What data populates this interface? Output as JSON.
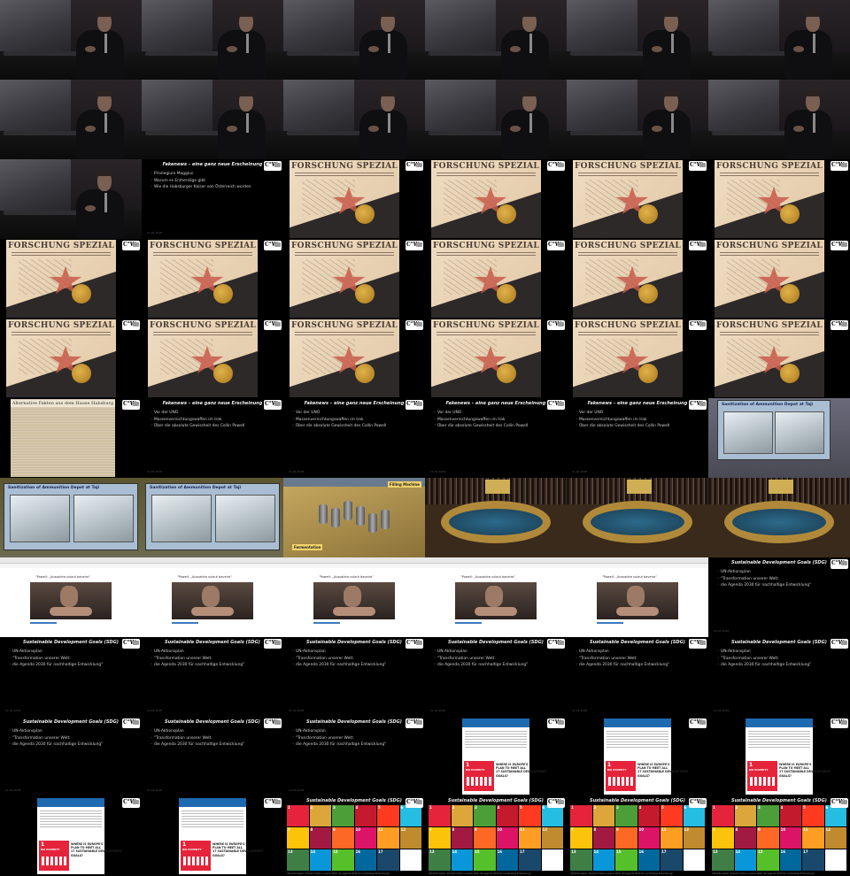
{
  "layout": {
    "columns": 6,
    "rows": 11,
    "cells": [
      "speaker",
      "speaker",
      "speaker",
      "speaker",
      "speaker",
      "speaker",
      "speaker",
      "speaker",
      "speaker",
      "speaker",
      "speaker",
      "speaker",
      "speaker",
      "fakenews-title",
      "newspaper",
      "newspaper",
      "newspaper",
      "newspaper",
      "newspaper",
      "newspaper",
      "newspaper",
      "newspaper",
      "newspaper",
      "newspaper",
      "newspaper",
      "newspaper",
      "newspaper",
      "newspaper",
      "newspaper",
      "newspaper",
      "oldpaper",
      "fakenews-uno",
      "fakenews-uno",
      "fakenews-uno",
      "fakenews-uno",
      "ammo-photo",
      "ammo",
      "ammo",
      "filling",
      "council",
      "council",
      "council",
      "browser",
      "browser",
      "browser",
      "browser",
      "browser",
      "sdg-text",
      "sdg-text",
      "sdg-text",
      "sdg-text",
      "sdg-text",
      "sdg-text",
      "sdg-text",
      "sdg-text",
      "sdg-text",
      "sdg-text",
      "sdg-poster",
      "sdg-poster",
      "sdg-poster",
      "sdg-poster",
      "sdg-poster",
      "sdg-grid",
      "sdg-grid",
      "sdg-grid",
      "sdg-grid"
    ]
  },
  "slides": {
    "fakenews_title": "Fakenews – eine ganz neue Erscheinung",
    "fakenews_bullets_1": [
      "Privilegium Maggius",
      "Warum es Erzherzöge gibt",
      "Wie die Habsburger Kaiser von Österreich wurden"
    ],
    "fakenews_bullets_2": [
      "Vor der UNO",
      "Massenvernichtungswaffen im Irak",
      "Über die absolute Gewissheit des Collin Powell"
    ],
    "sdg_title": "Sustainable Development Goals (SDG)",
    "sdg_bullets": [
      "UN-Aktionsplan",
      "\"Transformation unserer Welt:",
      "die Agenda 2030 für nachhaltige Entwicklung\""
    ],
    "date_stamp": "11.01.2018"
  },
  "newspaper": {
    "masthead": "FORSCHUNG SPEZIAL",
    "old_headline": "Alternative Fakten aus dem Hause Habsburg"
  },
  "photos": {
    "ammo_title": "Sanitization of Ammunition Depot at Taji",
    "filling_label": "Filling Machine",
    "fermentation_label": "Fermentation",
    "browser_headline": "\"Powell: „Aussaldra sulaut baveiro\""
  },
  "sdg_poster": {
    "goal_number": "1",
    "goal_name": "NO POVERTY",
    "claim": "WHERE IS EUROPE'S\nPLAN TO MEET ALL\n17 SUSTAINABLE DEVELOPMENT\nGOALS?"
  },
  "sdg_goals": [
    {
      "n": "1",
      "color": "#e5243b"
    },
    {
      "n": "2",
      "color": "#dda63a"
    },
    {
      "n": "3",
      "color": "#4c9f38"
    },
    {
      "n": "4",
      "color": "#c5192d"
    },
    {
      "n": "5",
      "color": "#ff3a21"
    },
    {
      "n": "6",
      "color": "#26bde2"
    },
    {
      "n": "7",
      "color": "#fcc30b"
    },
    {
      "n": "8",
      "color": "#a21942"
    },
    {
      "n": "9",
      "color": "#fd6925"
    },
    {
      "n": "10",
      "color": "#dd1367"
    },
    {
      "n": "11",
      "color": "#fd9d24"
    },
    {
      "n": "12",
      "color": "#bf8b2e"
    },
    {
      "n": "13",
      "color": "#3f7e44"
    },
    {
      "n": "14",
      "color": "#0a97d9"
    },
    {
      "n": "15",
      "color": "#56c02b"
    },
    {
      "n": "16",
      "color": "#00689d"
    },
    {
      "n": "17",
      "color": "#19486a"
    },
    {
      "n": "",
      "color": "#ffffff"
    }
  ],
  "sdg_caption": "UN-Aktionsplan „Transformation unserer Welt: die Agenda 2030 für nachhaltige Entwicklung\"",
  "logo_text": "C°W"
}
